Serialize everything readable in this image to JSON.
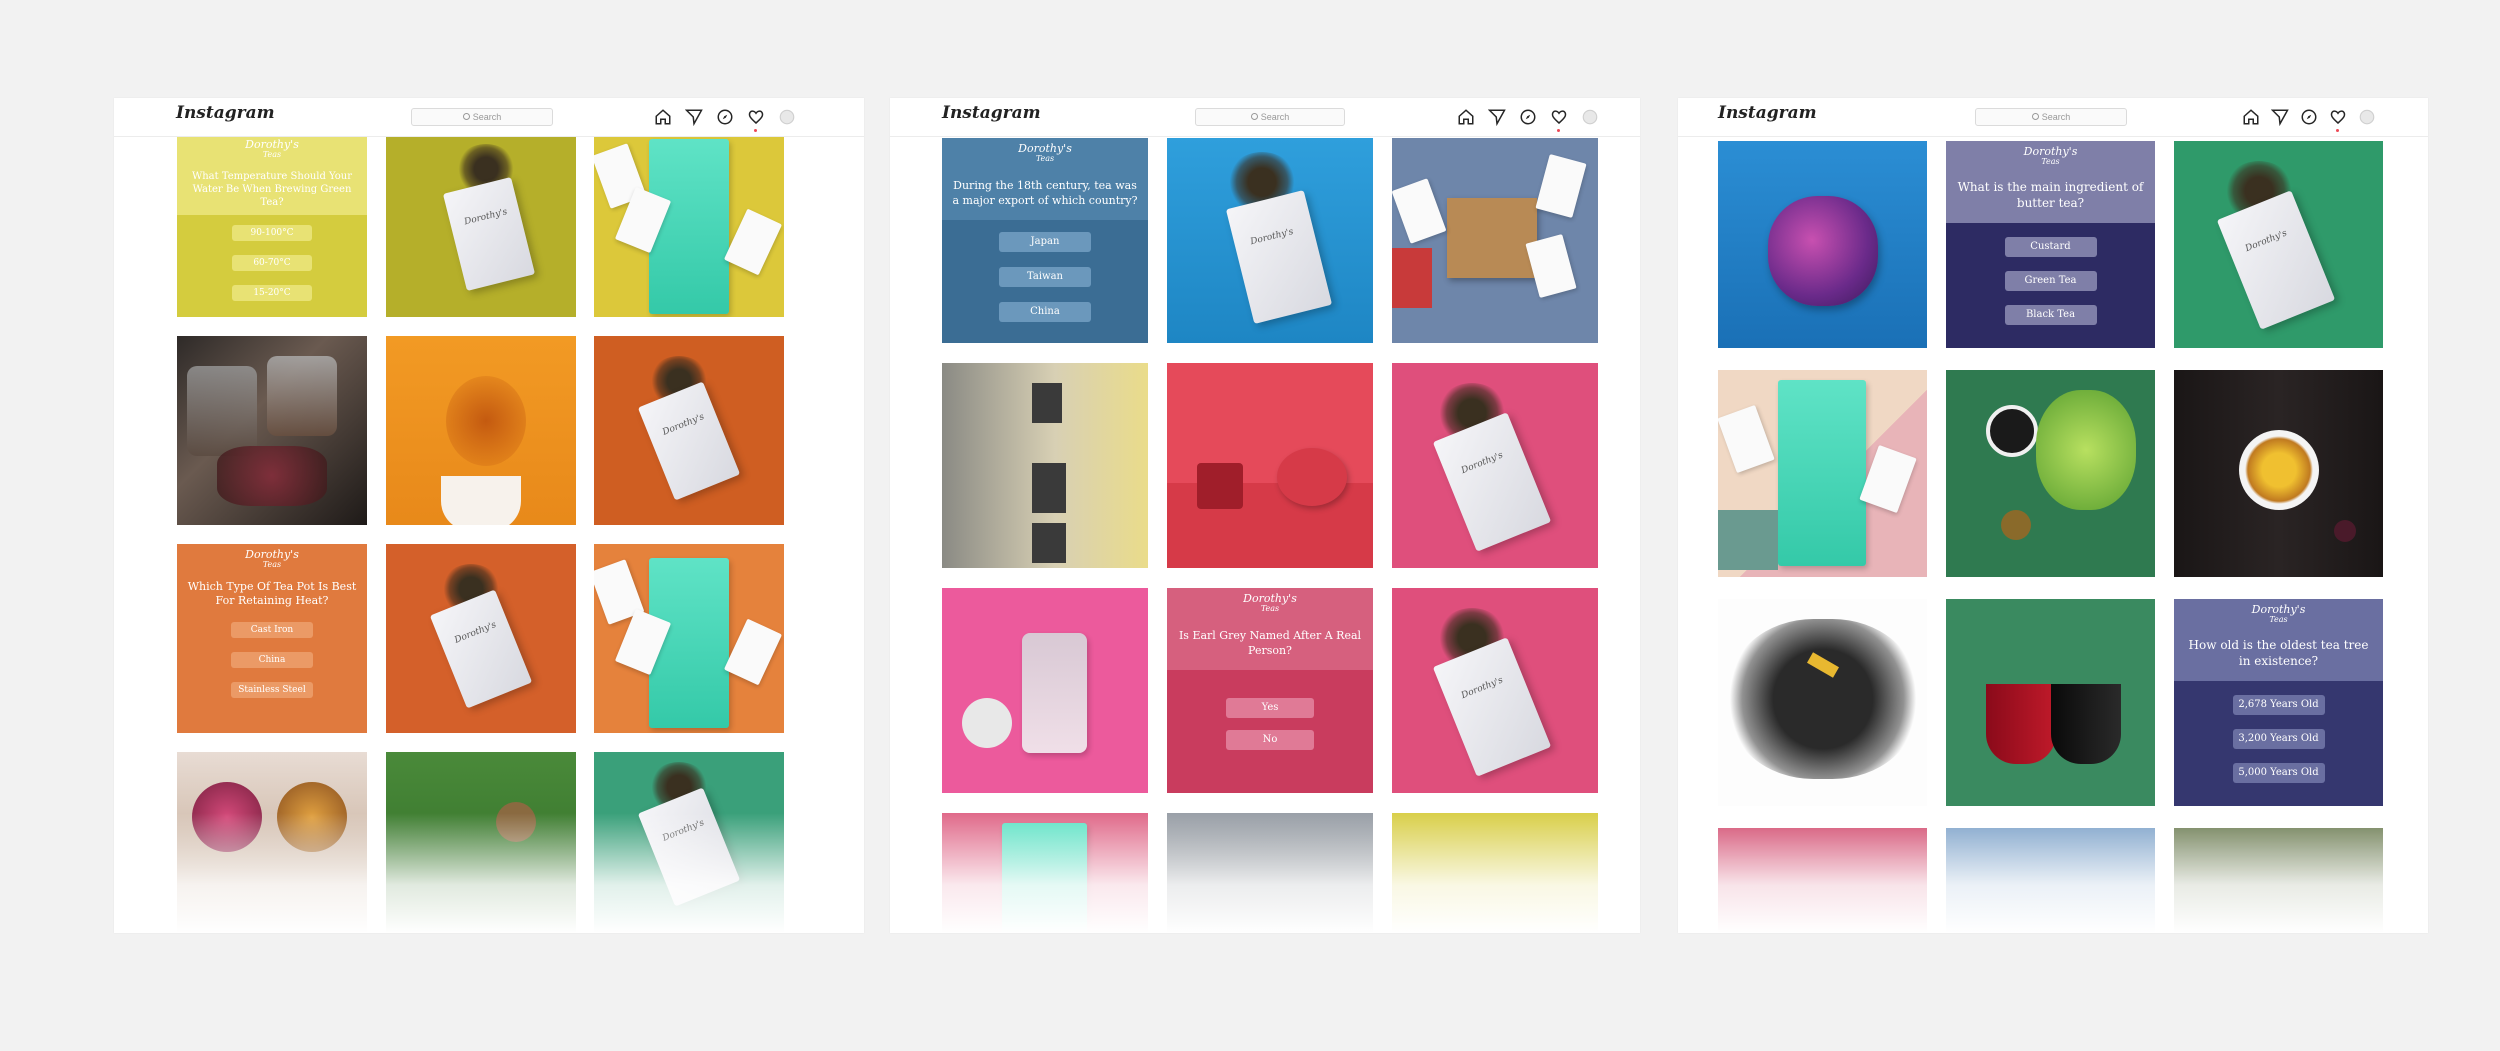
{
  "app": {
    "logo": "Instagram",
    "search_placeholder": "Search"
  },
  "icon_names": [
    "home-icon",
    "direct-icon",
    "explore-icon",
    "heart-icon",
    "profile-icon"
  ],
  "brand": {
    "name": "Dorothy's",
    "sub": "Teas"
  },
  "screens": [
    {
      "quizzes": [
        {
          "question": "What Temperature Should Your Water Be When Brewing Green Tea?",
          "answers": [
            "90-100°C",
            "60-70°C",
            "15-20°C"
          ],
          "bg": "#d4cc3e",
          "band": "#e8e274",
          "text": "#ffffff"
        },
        {
          "question": "Which Type Of Tea Pot Is Best For Retaining Heat?",
          "answers": [
            "Cast Iron",
            "China",
            "Stainless Steel"
          ],
          "bg": "#e07a3e",
          "band": "#e58a4e",
          "text": "#ffffff"
        }
      ]
    },
    {
      "quizzes": [
        {
          "question": "During the 18th century, tea was a major export of which country?",
          "answers": [
            "Japan",
            "Taiwan",
            "China"
          ],
          "bg": "#3b6d94",
          "band": "#4e81a8",
          "text": "#ffffff"
        },
        {
          "question": "Is Earl Grey Named After A Real Person?",
          "answers": [
            "Yes",
            "No"
          ],
          "bg": "#c93c5e",
          "band": "#d6607e",
          "text": "#ffffff"
        }
      ]
    },
    {
      "quizzes": [
        {
          "question": "What is the main ingredient of butter tea?",
          "answers": [
            "Custard",
            "Green Tea",
            "Black Tea"
          ],
          "bg": "#2d2b63",
          "band": "#7f7fa8",
          "text": "#ffffff"
        },
        {
          "question": "How old is the oldest tea tree in existence?",
          "answers": [
            "2,678 Years Old",
            "3,200 Years Old",
            "5,000 Years Old"
          ],
          "bg": "#35376f",
          "band": "#6a6fa1",
          "text": "#ffffff"
        }
      ]
    }
  ],
  "colors": {
    "page_bg": "#f2f2f2",
    "yellow": "#c9c232",
    "orange": "#f08a1c",
    "rust": "#d9692e",
    "teal": "#4fb98b",
    "blue": "#2ea0de",
    "pink": "#e04f7c",
    "red": "#e84c5c",
    "magenta": "#ec5a9c",
    "green": "#2f9a6a"
  }
}
